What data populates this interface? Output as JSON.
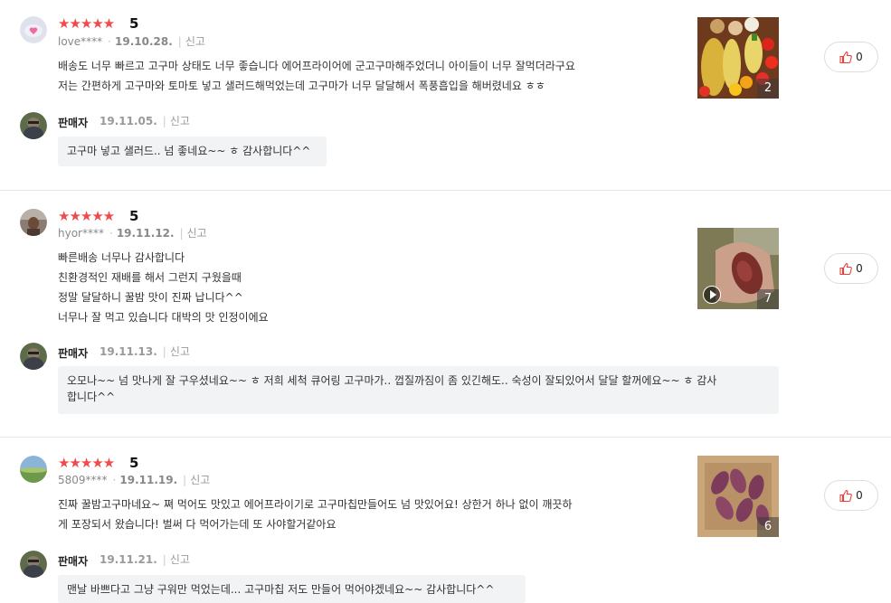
{
  "reviews": [
    {
      "stars": "★★★★★",
      "score": "5",
      "user": "love****",
      "date": "19.10.28.",
      "report": "신고",
      "lines": [
        "배송도 너무 빠르고 고구마 상태도 너무 좋습니다 에어프라이어에 군고구마해주었더니 아이들이 너무 잘먹더라구요",
        "저는 간편하게 고구마와 토마토 넣고 샐러드해먹었는데 고구마가 너무 달달해서 폭풍흡입을 해버렸네요 ㅎㅎ"
      ],
      "photo_count": "2",
      "likes": "0",
      "seller": {
        "name": "판매자",
        "date": "19.11.05.",
        "report": "신고",
        "reply": "고구마 넣고 샐러드.. 넘 좋네요~~ ㅎ 감사합니다^^"
      }
    },
    {
      "stars": "★★★★★",
      "score": "5",
      "user": "hyor****",
      "date": "19.11.12.",
      "report": "신고",
      "lines": [
        "빠른배송 너무나 감사합니다",
        "친환경적인 재배를 해서 그런지 구웠을때",
        "정말 달달하니 꿀밤 맛이 진짜 납니다^^",
        "너무나 잘 먹고 있습니다 대박의 맛 인정이에요"
      ],
      "photo_count": "7",
      "likes": "0",
      "seller": {
        "name": "판매자",
        "date": "19.11.13.",
        "report": "신고",
        "reply_lines": [
          "오모나~~ 넘 맛나게 잘 구우셨네요~~ ㅎ 저희 세척 큐어링 고구마가.. 껍질까짐이 좀 있긴해도.. 숙성이 잘되있어서 달달 할꺼에요~~ ㅎ 감사",
          "합니다^^"
        ]
      }
    },
    {
      "stars": "★★★★★",
      "score": "5",
      "user": "5809****",
      "date": "19.11.19.",
      "report": "신고",
      "lines": [
        "진짜 꿀밤고구마네요~ 쪄 먹어도 맛있고 에어프라이기로 고구마칩만들어도 넘  맛있어요! 상한거 하나 없이 깨끗하",
        "게 포장되서 왔습니다! 벌써 다 먹어가는데 또 사야할거같아요"
      ],
      "photo_count": "6",
      "likes": "0",
      "seller": {
        "name": "판매자",
        "date": "19.11.21.",
        "report": "신고",
        "reply": "맨날 바쁘다고 그냥 구워만 먹었는데... 고구마칩 저도 만들어 먹어야겠네요~~ 감사합니다^^"
      }
    }
  ],
  "colors": {
    "star": "#f04a4a",
    "like_icon": "#e8413c",
    "bubble_bg": "#f2f3f5"
  },
  "icons": {
    "like": "thumbs-up-icon",
    "play": "play-icon"
  }
}
